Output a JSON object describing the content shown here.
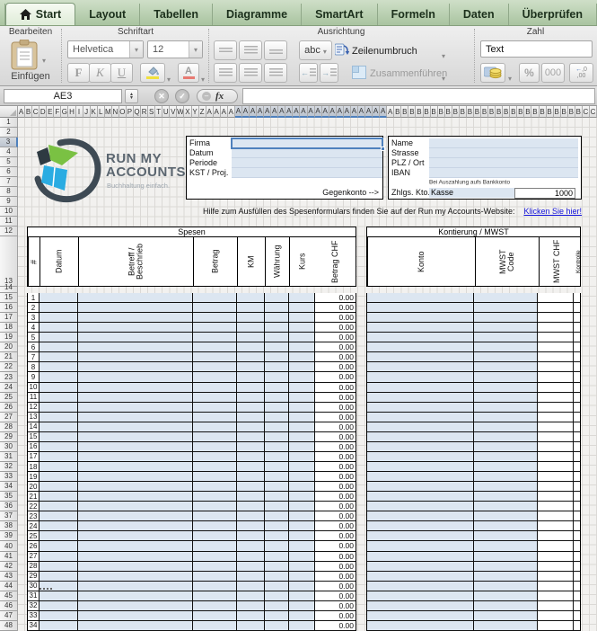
{
  "tabs": [
    {
      "label": "Start",
      "active": true
    },
    {
      "label": "Layout",
      "active": false
    },
    {
      "label": "Tabellen",
      "active": false
    },
    {
      "label": "Diagramme",
      "active": false
    },
    {
      "label": "SmartArt",
      "active": false
    },
    {
      "label": "Formeln",
      "active": false
    },
    {
      "label": "Daten",
      "active": false
    },
    {
      "label": "Überprüfen",
      "active": false
    }
  ],
  "ribbon": {
    "edit_group": {
      "label": "Bearbeiten",
      "paste": "Einfügen"
    },
    "font_group": {
      "label": "Schriftart",
      "font_name": "Helvetica",
      "font_size": "12",
      "bold": "F",
      "italic": "K",
      "underline": "U"
    },
    "align_group": {
      "label": "Ausrichtung",
      "abc": "abc",
      "wrap": "Zeilenumbruch",
      "merge": "Zusammenführen"
    },
    "number_group": {
      "label": "Zahl",
      "format": "Text",
      "percent": "%",
      "thousands": "000",
      "dec_top": ",0",
      "dec_bottom": ",00"
    }
  },
  "formula_bar": {
    "cell_ref": "AE3",
    "fx": "fx"
  },
  "sheet": {
    "column_letters": [
      "A",
      "B",
      "C",
      "D",
      "E",
      "F",
      "G",
      "H",
      "I",
      "J",
      "K",
      "L",
      "M",
      "N",
      "O",
      "P",
      "Q",
      "R",
      "S",
      "T",
      "U",
      "V",
      "W",
      "X",
      "Y",
      "Z",
      "A",
      "A",
      "A",
      "A",
      "A",
      "A",
      "A",
      "A",
      "A",
      "A",
      "A",
      "A",
      "A",
      "A",
      "A",
      "A",
      "A",
      "A",
      "A",
      "A",
      "A",
      "A",
      "A",
      "A",
      "A",
      "A",
      "B",
      "B",
      "B",
      "B",
      "B",
      "B",
      "B",
      "B",
      "B",
      "B",
      "B",
      "B",
      "B",
      "B",
      "B",
      "B",
      "B",
      "B",
      "B",
      "B",
      "B",
      "B",
      "B",
      "B",
      "B",
      "B",
      "C",
      "C"
    ],
    "row_count": 48,
    "selection": {
      "cell": "AE3",
      "row_header": 3,
      "col_start": 30,
      "col_end": 50
    }
  },
  "logo": {
    "line1": "RUN MY",
    "line2": "ACCOUNTS",
    "tagline": "Buchhaltung einfach."
  },
  "form_left": {
    "labels": [
      "Firma",
      "Datum",
      "Periode",
      "KST / Proj."
    ],
    "counter_label": "Gegenkonto -->"
  },
  "form_right": {
    "labels": [
      "Name",
      "Strasse",
      "PLZ / Ort",
      "IBAN"
    ],
    "note": "Bei Auszahlung aufs Bankkonto",
    "payment_label": "Zhlgs. Kto.",
    "payment_method": "Kasse",
    "payment_account": "1000"
  },
  "help": {
    "text": "Hilfe zum Ausfüllen des Spesenformulars finden Sie auf der Run my Accounts-Website:",
    "link_text": "Klicken Sie hier!"
  },
  "expense_table": {
    "title": "Spesen",
    "headers": [
      "#",
      "Datum",
      "Betreff /\nBeschrieb",
      "Betrag",
      "KM",
      "Währung",
      "Kurs",
      "Betrag CHF"
    ],
    "row_numbers": [
      1,
      2,
      3,
      4,
      5,
      6,
      7,
      8,
      9,
      10,
      11,
      12,
      13,
      14,
      15,
      16,
      17,
      18,
      19,
      20,
      21,
      22,
      23,
      24,
      25,
      26,
      27,
      28,
      29,
      30,
      31,
      32,
      33,
      34
    ],
    "amount_value": "0.00"
  },
  "account_table": {
    "title": "Kontierung / MWST",
    "headers": [
      "Konto",
      "MWST\nCode",
      "MWST CHF",
      "Kontrolle"
    ]
  },
  "colors": {
    "selection_blue": "#4f81bd",
    "input_fill": "#dce6f1",
    "link_blue": "#1414dd",
    "tab_green": "#b7d1af",
    "logo_green": "#7ac143",
    "logo_blue": "#2aace2",
    "logo_dark": "#3e4a54"
  }
}
